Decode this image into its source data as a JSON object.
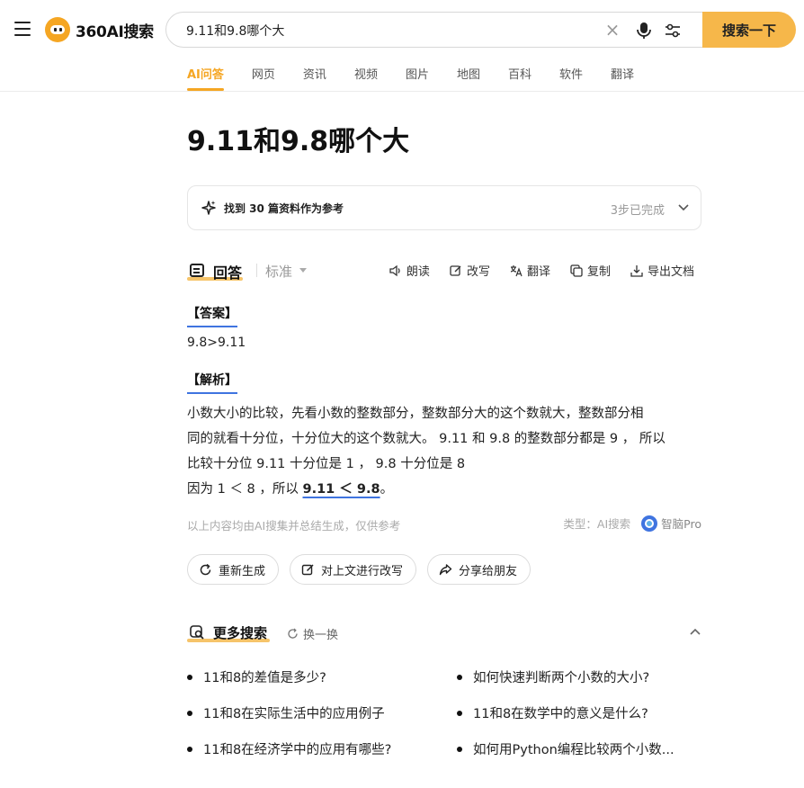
{
  "header": {
    "logo_text": "360AI搜索",
    "search_value": "9.11和9.8哪个大",
    "clear_glyph": "×",
    "search_button": "搜索一下"
  },
  "tabs": [
    {
      "label": "AI问答",
      "active": true
    },
    {
      "label": "网页"
    },
    {
      "label": "资讯"
    },
    {
      "label": "视频"
    },
    {
      "label": "图片"
    },
    {
      "label": "地图"
    },
    {
      "label": "百科"
    },
    {
      "label": "软件"
    },
    {
      "label": "翻译"
    }
  ],
  "main": {
    "title": "9.11和9.8哪个大",
    "refs": {
      "text": "找到 30 篇资料作为参考",
      "status": "3步已完成"
    },
    "answer_header": {
      "label": "回答",
      "mode": "标准",
      "tools": [
        "朗读",
        "改写",
        "翻译",
        "复制",
        "导出文档"
      ]
    },
    "answer_section": "【答案】",
    "answer_value": "9.8>9.11",
    "analysis_section": "【解析】",
    "analysis_lines": [
      "小数大小的比较，先看小数的整数部分，整数部分大的这个数就大，整数部分相",
      "同的就看十分位，十分位大的这个数就大。 9.11 和 9.8 的整数部分都是 9 ， 所以",
      "比较十分位 9.11 十分位是 1 ， 9.8 十分位是 8"
    ],
    "conclusion_prefix": "因为 1 ＜ 8 ，所以 ",
    "conclusion_highlight": "9.11 ＜ 9.8",
    "conclusion_suffix": "。",
    "disclaimer": "以上内容均由AI搜集并总结生成，仅供参考",
    "type_label": "类型：AI搜索",
    "brand": "智脑Pro",
    "actions": [
      "重新生成",
      "对上文进行改写",
      "分享给朋友"
    ]
  },
  "more": {
    "label": "更多搜索",
    "refresh": "换一换",
    "items": [
      "11和8的差值是多少?",
      "如何快速判断两个小数的大小?",
      "11和8在实际生活中的应用例子",
      "11和8在数学中的意义是什么?",
      "11和8在经济学中的应用有哪些?",
      "如何用Python编程比较两个小数..."
    ]
  },
  "colors": {
    "accent": "#f5a623",
    "button": "#f6b74a",
    "link_underline": "#3f74e0"
  },
  "icons": [
    "menu-icon",
    "logo-icon",
    "clear-icon",
    "microphone-icon",
    "filter-icon",
    "sparkle-icon",
    "chevron-down-icon",
    "answer-icon",
    "speaker-icon",
    "edit-icon",
    "translate-icon",
    "copy-icon",
    "export-icon",
    "brain-icon",
    "refresh-icon",
    "search-more-icon",
    "chevron-up-icon"
  ]
}
